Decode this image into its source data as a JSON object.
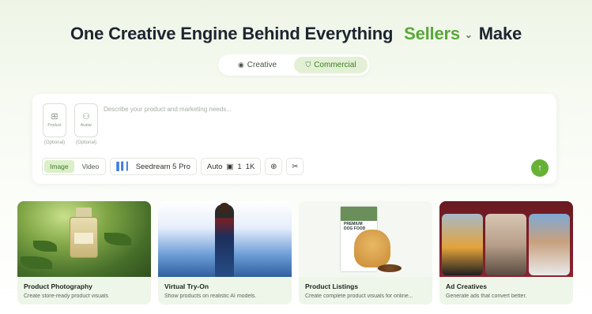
{
  "headline": {
    "prefix": "One Creative Engine Behind Everything",
    "rotating_word": "Sellers",
    "suffix": "Make"
  },
  "mode_toggle": {
    "options": [
      {
        "label": "Creative",
        "icon": "palette-icon",
        "active": false
      },
      {
        "label": "Commercial",
        "icon": "shopping-bag-icon",
        "active": true
      }
    ]
  },
  "composer": {
    "slots": [
      {
        "label": "Product",
        "caption": "(Optional)",
        "icon": "add-image-icon"
      },
      {
        "label": "Avatar",
        "caption": "(Optional)",
        "icon": "person-icon"
      }
    ],
    "placeholder": "Describe your product and marketing needs...",
    "media_type": {
      "options": [
        "Image",
        "Video"
      ],
      "selected": "Image"
    },
    "model": "Seedream 5 Pro",
    "aspect": "Auto",
    "count": "1",
    "resolution": "1K",
    "accent_color": "#67b136"
  },
  "cards": [
    {
      "title": "Product Photography",
      "desc": "Create store-ready product visuals"
    },
    {
      "title": "Virtual Try-On",
      "desc": "Show products on realistic AI models."
    },
    {
      "title": "Product Listings",
      "desc": "Create complete product visuals for online..."
    },
    {
      "title": "Ad Creatives",
      "desc": "Generate ads that convert better."
    }
  ],
  "product_bag": {
    "line1": "PREMIUM",
    "line2": "DOG FOOD"
  }
}
